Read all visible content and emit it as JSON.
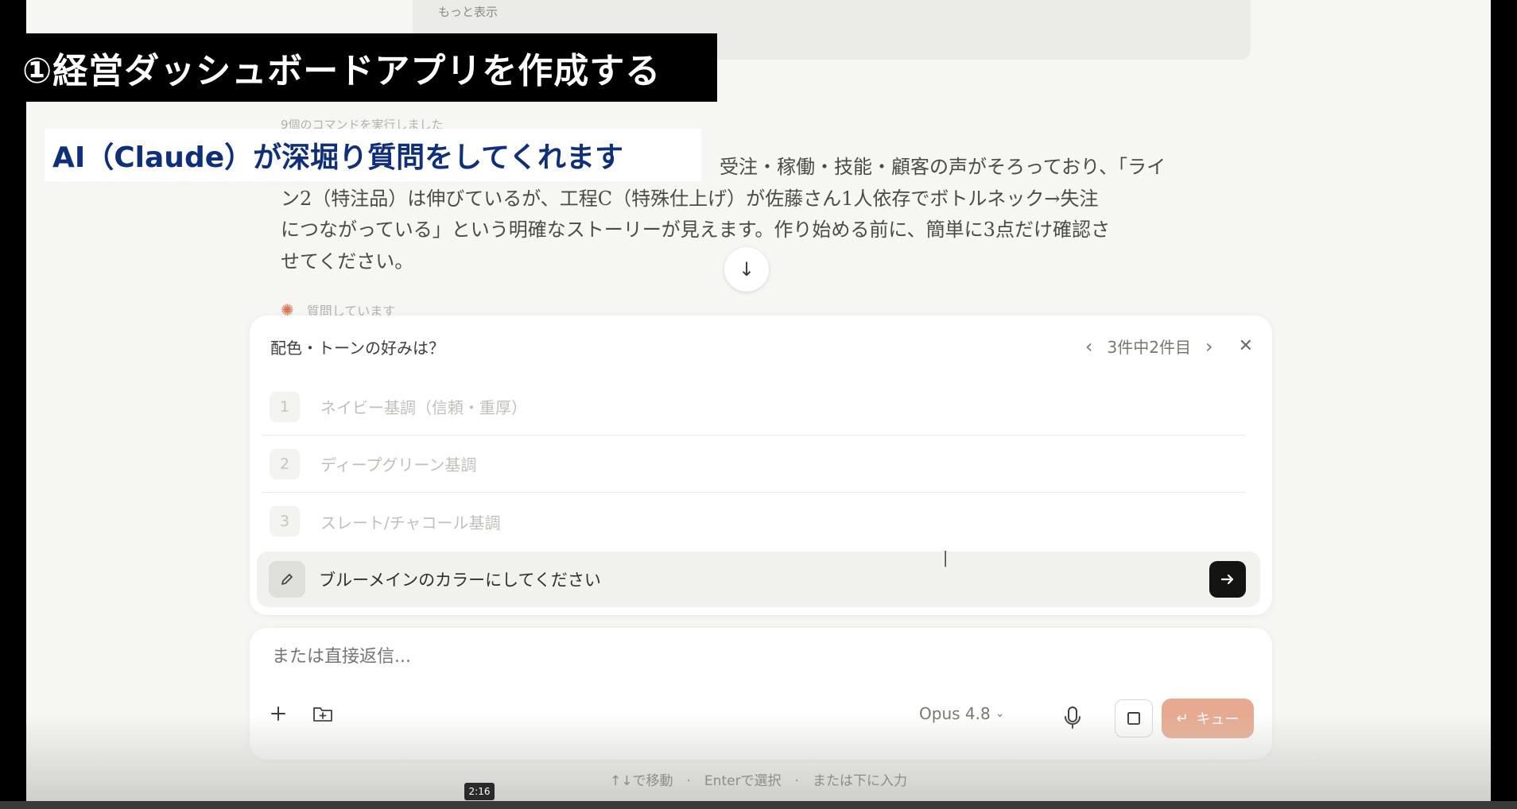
{
  "overlay": {
    "title": "①経営ダッシュボードアプリを作成する",
    "subtitle": "AI（Claude）が深堀り質問をしてくれます"
  },
  "conversation": {
    "prev_text_faint": "もっと表示",
    "prev_more_label": "もっと表示",
    "commands_run": "9個のコマンドを実行しました",
    "message_lines": [
      "受注・稼働・技能・顧客の声がそろっており、「ライ",
      "ン2（特注品）は伸びているが、工程C（特殊仕上げ）が佐藤さん1人依存でボトルネック→失注",
      "につながっている」という明確なストーリーが見えます。作り始める前に、簡単に3点だけ確認さ",
      "せてください。"
    ],
    "thinking_label": "質問しています"
  },
  "question_card": {
    "title": "配色・トーンの好みは？",
    "pager": "3件中2件目",
    "options": [
      {
        "num": "1",
        "label": "ネイビー基調（信頼・重厚）"
      },
      {
        "num": "2",
        "label": "ディープグリーン基調"
      },
      {
        "num": "3",
        "label": "スレート/チャコール基調"
      }
    ],
    "custom_answer": "ブルーメインのカラーにしてください"
  },
  "composer": {
    "placeholder": "または直接返信...",
    "model": "Opus 4.8",
    "queue_label": "キュー"
  },
  "footer_hint": "↑↓で移動　·　Enterで選択　·　または下に入力",
  "video": {
    "timestamp": "2:16"
  },
  "colors": {
    "accent": "#d97757",
    "queue_button": "#e7a98f",
    "subtitle_text": "#0f2f7a"
  }
}
